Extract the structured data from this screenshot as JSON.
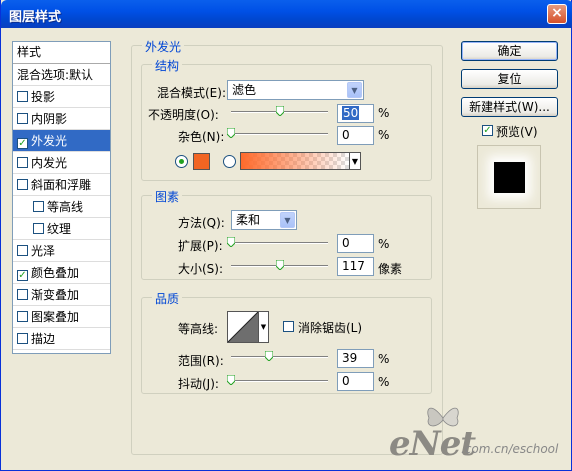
{
  "window": {
    "title": "图层样式",
    "close": "×"
  },
  "style_list": {
    "header": "样式",
    "blend_default": "混合选项:默认",
    "items": [
      {
        "label": "投影",
        "checked": false
      },
      {
        "label": "内阴影",
        "checked": false
      },
      {
        "label": "外发光",
        "checked": true,
        "selected": true
      },
      {
        "label": "内发光",
        "checked": false
      },
      {
        "label": "斜面和浮雕",
        "checked": false
      },
      {
        "label": "等高线",
        "checked": false,
        "sub": true
      },
      {
        "label": "纹理",
        "checked": false,
        "sub": true
      },
      {
        "label": "光泽",
        "checked": false
      },
      {
        "label": "颜色叠加",
        "checked": true
      },
      {
        "label": "渐变叠加",
        "checked": false
      },
      {
        "label": "图案叠加",
        "checked": false
      },
      {
        "label": "描边",
        "checked": false
      }
    ]
  },
  "outer_glow": {
    "title": "外发光",
    "structure": {
      "title": "结构",
      "blend_mode_label": "混合模式(E):",
      "blend_mode_value": "滤色",
      "opacity_label": "不透明度(O):",
      "opacity_value": "50",
      "opacity_unit": "%",
      "opacity_level": 0.5,
      "noise_label": "杂色(N):",
      "noise_value": "0",
      "noise_unit": "%",
      "noise_level": 0,
      "glow_color": "#f26522",
      "gradient_color": "#ff6a2b"
    },
    "elements": {
      "title": "图素",
      "method_label": "方法(Q):",
      "method_value": "柔和",
      "spread_label": "扩展(P):",
      "spread_value": "0",
      "spread_unit": "%",
      "spread_level": 0,
      "size_label": "大小(S):",
      "size_value": "117",
      "size_unit": "像素",
      "size_level": 0.5
    },
    "quality": {
      "title": "品质",
      "contour_label": "等高线:",
      "anti_alias_label": "消除锯齿(L)",
      "anti_alias_checked": false,
      "range_label": "范围(R):",
      "range_value": "39",
      "range_unit": "%",
      "range_level": 0.39,
      "jitter_label": "抖动(J):",
      "jitter_value": "0",
      "jitter_unit": "%",
      "jitter_level": 0
    }
  },
  "buttons": {
    "ok": "确定",
    "reset": "复位",
    "new_style": "新建样式(W)..."
  },
  "preview": {
    "label": "预览(V)",
    "checked": true
  },
  "watermark": {
    "brand": "eNet",
    "url": ".com.cn/eschool"
  }
}
